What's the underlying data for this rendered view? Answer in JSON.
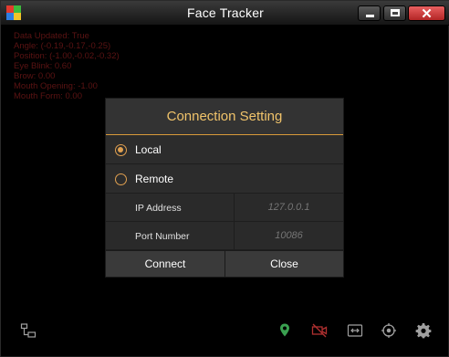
{
  "window": {
    "title": "Face Tracker",
    "close_glyph": "✕"
  },
  "debug_lines": [
    "Data Updated: True",
    "Angle: (-0.19,-0.17,-0.25)",
    "Position: (-1.00,-0.02,-0.32)",
    "Eye Blink: 0.60",
    "Brow: 0.00",
    "Mouth Opening: -1.00",
    "Mouth Form: 0.00"
  ],
  "dialog": {
    "title": "Connection Setting",
    "options": [
      {
        "label": "Local",
        "checked": true
      },
      {
        "label": "Remote",
        "checked": false
      }
    ],
    "fields": {
      "ip_label": "IP Address",
      "ip_placeholder": "127.0.0.1",
      "port_label": "Port Number",
      "port_placeholder": "10086"
    },
    "connect_label": "Connect",
    "close_label": "Close"
  },
  "toolbar": {
    "icons": [
      "network-icon",
      "location-pin-icon",
      "camera-off-icon",
      "frame-icon",
      "target-icon",
      "gear-icon"
    ],
    "colors": {
      "default": "#a0a0a0",
      "pin": "#3aa050",
      "camera_off": "#b03030"
    }
  },
  "colors": {
    "accent": "#f0c36a",
    "debug_text": "#7a1a1a",
    "close_button": "#c83a3a"
  }
}
